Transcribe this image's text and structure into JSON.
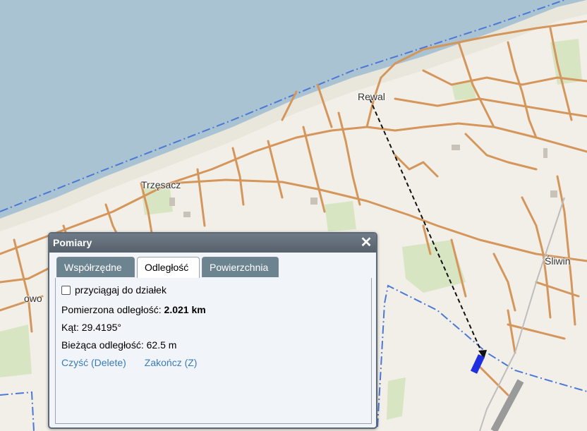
{
  "map": {
    "place_labels": {
      "rewal": "Rewal",
      "trzesacz": "Trzęsacz",
      "sliwin": "Śliwin",
      "cut_left": "owo"
    },
    "colors": {
      "sea": "#aac3d3",
      "land": "#f2efe9",
      "road": "#d4965a",
      "border": "#4b78d6",
      "measure_line": "#111111",
      "marker": "#1f2fe0"
    }
  },
  "dialog": {
    "title": "Pomiary",
    "close_glyph": "✕",
    "tabs": [
      {
        "label": "Współrzędne",
        "active": false
      },
      {
        "label": "Odległość",
        "active": true
      },
      {
        "label": "Powierzchnia",
        "active": false
      }
    ],
    "snap_checkbox": {
      "label": "przyciągaj do działek",
      "checked": false
    },
    "measured": {
      "label": "Pomierzona odległość: ",
      "value": "2.021 km"
    },
    "angle": {
      "label": "Kąt: ",
      "value": "29.4195°"
    },
    "current": {
      "label": "Bieżąca odległość: ",
      "value": "62.5 m"
    },
    "links": {
      "clear": "Czyść (Delete)",
      "finish": "Zakończ (Z)"
    }
  }
}
